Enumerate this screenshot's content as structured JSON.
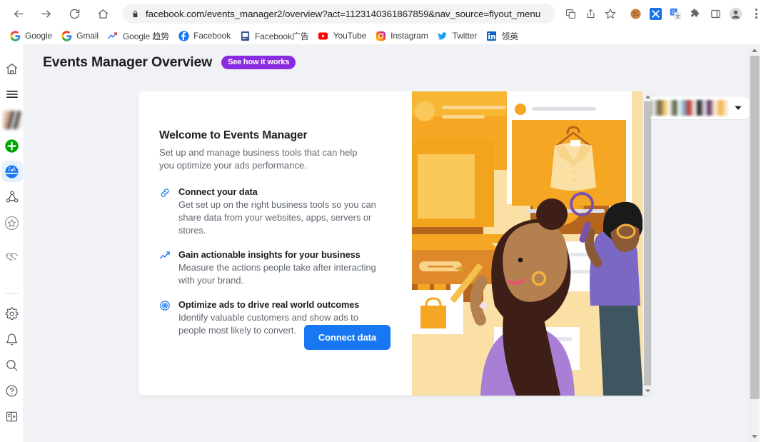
{
  "browser": {
    "url": "facebook.com/events_manager2/overview?act=1123140361867859&nav_source=flyout_menu",
    "nav": {
      "back": "Back",
      "forward": "Forward",
      "reload": "Reload",
      "home": "Home"
    },
    "omnibox_actions": [
      "translate-icon",
      "share-icon",
      "bookmark-star-icon"
    ],
    "extensions": [
      "cookie-extension-icon",
      "blue-x-extension-icon",
      "google-translate-extension-icon",
      "puzzle-extensions-icon",
      "side-panel-icon",
      "profile-avatar-icon"
    ],
    "menu": "chrome-menu",
    "bookmarks": [
      {
        "label": "Google",
        "icon": "google-g-icon"
      },
      {
        "label": "Gmail",
        "icon": "gmail-icon"
      },
      {
        "label": "Google 趋势",
        "icon": "google-trends-icon"
      },
      {
        "label": "Facebook",
        "icon": "facebook-icon"
      },
      {
        "label": "Facebook广告",
        "icon": "facebook-ads-icon"
      },
      {
        "label": "YouTube",
        "icon": "youtube-icon"
      },
      {
        "label": "Instagram",
        "icon": "instagram-icon"
      },
      {
        "label": "Twitter",
        "icon": "twitter-icon"
      },
      {
        "label": "领英",
        "icon": "linkedin-icon"
      }
    ]
  },
  "sidebar": {
    "items": [
      {
        "name": "home",
        "icon": "home-icon",
        "active": false
      },
      {
        "name": "menu",
        "icon": "hamburger-menu-icon",
        "active": false
      },
      {
        "name": "account-avatar",
        "icon": "avatar-blurred",
        "active": false
      },
      {
        "name": "create",
        "icon": "green-plus-icon",
        "active": false
      },
      {
        "name": "events-manager",
        "icon": "gauge-icon",
        "active": true
      },
      {
        "name": "audiences",
        "icon": "network-nodes-icon",
        "active": false
      },
      {
        "name": "favorites",
        "icon": "star-icon",
        "active": false
      },
      {
        "name": "partnerships",
        "icon": "handshake-icon",
        "active": false
      }
    ],
    "bottom_items": [
      {
        "name": "settings",
        "icon": "gear-icon"
      },
      {
        "name": "notifications",
        "icon": "bell-icon"
      },
      {
        "name": "search",
        "icon": "search-icon"
      },
      {
        "name": "help",
        "icon": "help-circle-icon"
      },
      {
        "name": "collapse-panel",
        "icon": "panel-toggle-icon"
      }
    ]
  },
  "header": {
    "title": "Events Manager Overview",
    "badge": "See how it works",
    "badge_color": "#8a2be2"
  },
  "account_selector": {
    "icon": "account-list-icon",
    "value": "",
    "caret": "chevron-down-icon"
  },
  "card": {
    "heading": "Welcome to Events Manager",
    "subheading": "Set up and manage business tools that can help you optimize your ads performance.",
    "features": [
      {
        "icon": "link-chain-icon",
        "title": "Connect your data",
        "desc": "Get set up on the right business tools so you can share data from your websites, apps, servers or stores."
      },
      {
        "icon": "trend-line-icon",
        "title": "Gain actionable insights for your business",
        "desc": "Measure the actions people take after interacting with your brand."
      },
      {
        "icon": "target-bullseye-icon",
        "title": "Optimize ads to drive real world outcomes",
        "desc": "Identify valuable customers and show ads to people most likely to convert."
      }
    ],
    "cta": "Connect data",
    "cta_color": "#1877f2",
    "illustration": "two-people-reviewing-ecommerce-analytics"
  }
}
